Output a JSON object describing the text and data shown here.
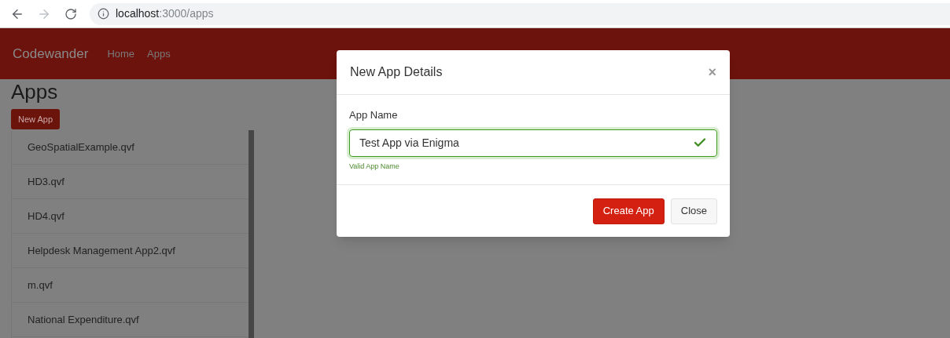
{
  "browser": {
    "url_host": "localhost",
    "url_path": ":3000/apps",
    "forward_disabled": true
  },
  "navbar": {
    "brand": "Codewander",
    "links": [
      "Home",
      "Apps"
    ]
  },
  "page": {
    "title": "Apps",
    "new_button": "New App",
    "apps": [
      "GeoSpatialExample.qvf",
      "HD3.qvf",
      "HD4.qvf",
      "Helpdesk Management App2.qvf",
      "m.qvf",
      "National Expenditure.qvf"
    ]
  },
  "modal": {
    "title": "New App Details",
    "close_symbol": "×",
    "field_label": "App Name",
    "field_value": "Test App via Enigma",
    "valid": true,
    "help": "Valid App Name",
    "buttons": [
      {
        "label": "Create App",
        "kind": "primary"
      },
      {
        "label": "Close",
        "kind": "default"
      }
    ]
  }
}
